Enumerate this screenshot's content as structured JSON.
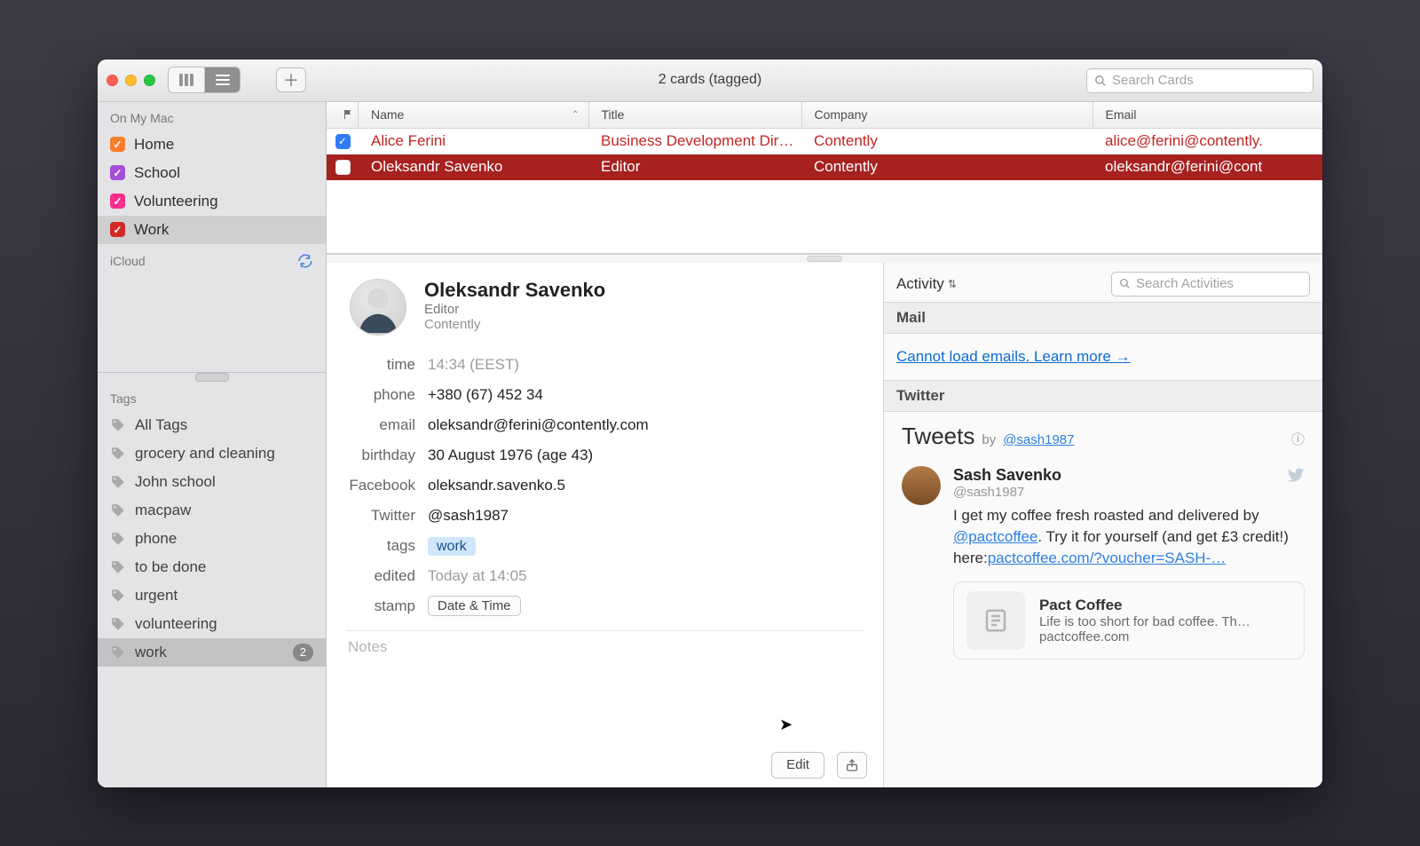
{
  "window_title": "2 cards (tagged)",
  "search_cards_placeholder": "Search Cards",
  "sidebar": {
    "section_mac": "On My Mac",
    "section_icloud": "iCloud",
    "section_tags": "Tags",
    "smartlists": [
      {
        "label": "Home",
        "color": "orange"
      },
      {
        "label": "School",
        "color": "purple"
      },
      {
        "label": "Volunteering",
        "color": "magenta"
      },
      {
        "label": "Work",
        "color": "red",
        "selected": true
      }
    ],
    "tags": [
      {
        "label": "All Tags"
      },
      {
        "label": "grocery and cleaning"
      },
      {
        "label": "John school"
      },
      {
        "label": "macpaw"
      },
      {
        "label": "phone"
      },
      {
        "label": "to be done"
      },
      {
        "label": "urgent"
      },
      {
        "label": "volunteering"
      },
      {
        "label": "work",
        "selected": true,
        "count": "2"
      }
    ]
  },
  "list": {
    "columns": {
      "name": "Name",
      "title": "Title",
      "company": "Company",
      "email": "Email"
    },
    "rows": [
      {
        "name": "Alice Ferini",
        "title": "Business Development Dire…",
        "company": "Contently",
        "email": "alice@ferini@contently.",
        "flagged": true
      },
      {
        "name": "Oleksandr Savenko",
        "title": "Editor",
        "company": "Contently",
        "email": "oleksandr@ferini@cont",
        "selected": true
      }
    ]
  },
  "card": {
    "name": "Oleksandr Savenko",
    "role": "Editor",
    "company": "Contently",
    "fields": {
      "time_label": "time",
      "time": "14:34 (EEST)",
      "phone_label": "phone",
      "phone": "+380 (67) 452 34",
      "email_label": "email",
      "email": "oleksandr@ferini@contently.com",
      "birthday_label": "birthday",
      "birthday": "30 August 1976 (age 43)",
      "facebook_label": "Facebook",
      "facebook": "oleksandr.savenko.5",
      "twitter_label": "Twitter",
      "twitter": "@sash1987",
      "tags_label": "tags",
      "tag_chip": "work",
      "edited_label": "edited",
      "edited": "Today at 14:05",
      "stamp_label": "stamp",
      "stamp_button": "Date & Time"
    },
    "notes_placeholder": "Notes",
    "edit": "Edit"
  },
  "activity": {
    "dropdown": "Activity",
    "search_placeholder": "Search Activities",
    "mail_header": "Mail",
    "mail_error": "Cannot load emails. Learn more →",
    "twitter_header": "Twitter",
    "tweets": {
      "title": "Tweets",
      "by": "by",
      "handle": "@sash1987",
      "tweet": {
        "name": "Sash Savenko",
        "handle": "@sash1987",
        "text_pre": "I get my coffee fresh roasted and delivered by ",
        "mention": "@pactcoffee",
        "text_mid": ". Try it for yourself (and get £3 credit!) here:",
        "url": "pactcoffee.com/?voucher=SASH-…"
      },
      "card": {
        "title": "Pact Coffee",
        "sub": "Life is too short for bad coffee. Th…",
        "domain": "pactcoffee.com"
      }
    }
  }
}
